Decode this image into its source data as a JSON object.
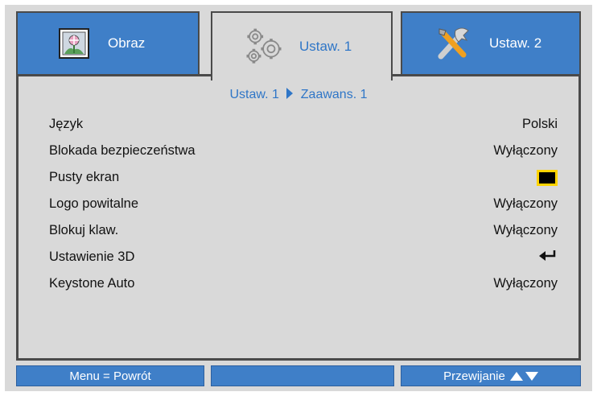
{
  "tabs": [
    {
      "label": "Obraz",
      "icon": "picture-icon",
      "active": false
    },
    {
      "label": "Ustaw. 1",
      "icon": "gears-icon",
      "active": true
    },
    {
      "label": "Ustaw. 2",
      "icon": "tools-icon",
      "active": false
    }
  ],
  "breadcrumb": {
    "parent": "Ustaw. 1",
    "separator_icon": "triangle-right-icon",
    "child": "Zaawans. 1"
  },
  "rows": [
    {
      "label": "Język",
      "value": "Polski"
    },
    {
      "label": "Blokada bezpieczeństwa",
      "value": "Wyłączony"
    },
    {
      "label": "Pusty ekran",
      "value_icon": "black-color-swatch-icon",
      "swatch_color": "#000000",
      "highlight_color": "#ffd400"
    },
    {
      "label": "Logo powitalne",
      "value": "Wyłączony"
    },
    {
      "label": "Blokuj klaw.",
      "value": "Wyłączony"
    },
    {
      "label": "Ustawienie 3D",
      "value_icon": "enter-arrow-icon"
    },
    {
      "label": "Keystone Auto",
      "value": "Wyłączony"
    }
  ],
  "footer": {
    "left": "Menu = Powrót",
    "middle": "",
    "right": "Przewijanie",
    "right_icons": [
      "arrow-up-icon",
      "arrow-down-icon"
    ]
  },
  "colors": {
    "accent": "#3f7fc8",
    "text_blue": "#2f76c7",
    "panel": "#d9d9d9",
    "border": "#4a4a4a"
  }
}
